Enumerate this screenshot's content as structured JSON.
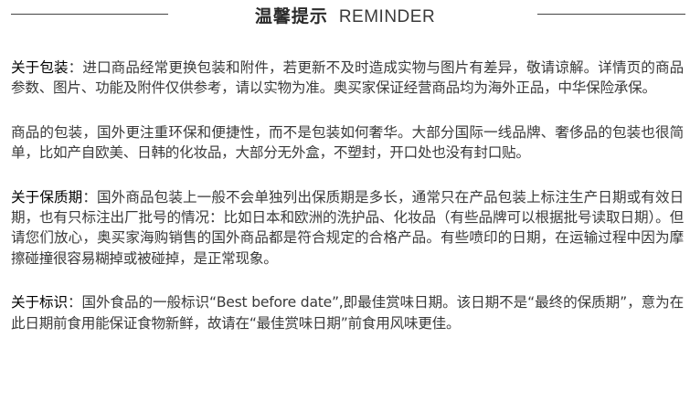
{
  "header": {
    "title_cn": "温馨提示",
    "title_en": "REMINDER"
  },
  "paragraphs": [
    {
      "label": "关于包装",
      "text": "：进口商品经常更换包装和附件，若更新不及时造成实物与图片有差异，敬请谅解。详情页的商品参数、图片、功能及附件仅供参考，请以实物为准。奥买家保证经营商品均为海外正品，中华保险承保。"
    },
    {
      "label": "",
      "text": "商品的包装，国外更注重环保和便捷性，而不是包装如何奢华。大部分国际一线品牌、奢侈品的包装也很简单，比如产自欧美、日韩的化妆品，大部分无外盒，不塑封，开口处也没有封口贴。"
    },
    {
      "label": "关于保质期",
      "text": "：国外商品包装上一般不会单独列出保质期是多长，通常只在产品包装上标注生产日期或有效日期，也有只标注出厂批号的情况：比如日本和欧洲的洗护品、化妆品（有些品牌可以根据批号读取日期）。但请您们放心，奥买家海购销售的国外商品都是符合规定的合格产品。有些喷印的日期，在运输过程中因为摩擦碰撞很容易糊掉或被碰掉，是正常现象。"
    },
    {
      "label": "关于标识",
      "text": "：国外食品的一般标识“Best before date”,即最佳赏味日期。该日期不是“最终的保质期”，意为在此日期前食用能保证食物新鲜，故请在“最佳赏味日期”前食用风味更佳。"
    }
  ]
}
